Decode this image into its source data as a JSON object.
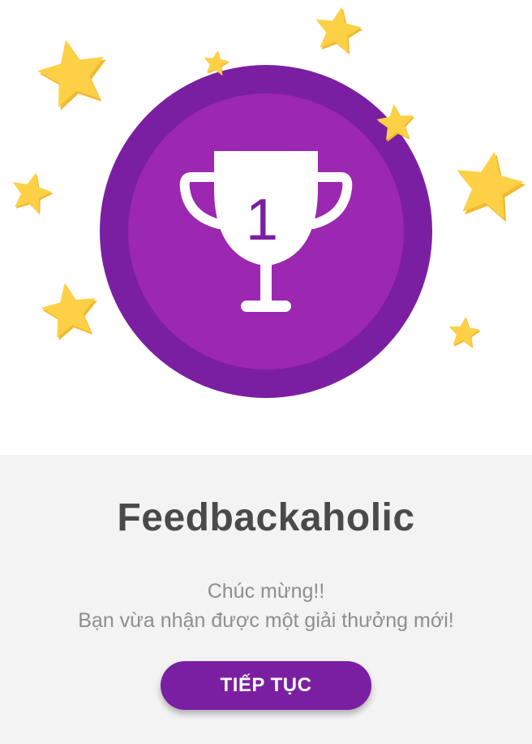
{
  "badge": {
    "rank_number": "1",
    "icon": "trophy-icon",
    "star_icon": "star-icon",
    "colors": {
      "outer_ring": "#7b1fa2",
      "inner_circle": "#9c27b0",
      "trophy": "#ffffff",
      "number": "#7b1fa2",
      "star": "#fdd046",
      "star_shade": "#f3b830"
    }
  },
  "award": {
    "title": "Feedbackaholic",
    "message_line1": "Chúc mừng!!",
    "message_line2": "Bạn vừa nhận được một giải thưởng mới!"
  },
  "continue_button": {
    "label": "TIẾP TỤC",
    "color": "#7b1fa2"
  },
  "colors": {
    "panel_background": "#f3f3f3",
    "title_text": "#4a4a4a",
    "message_text": "#8e8e8e"
  }
}
